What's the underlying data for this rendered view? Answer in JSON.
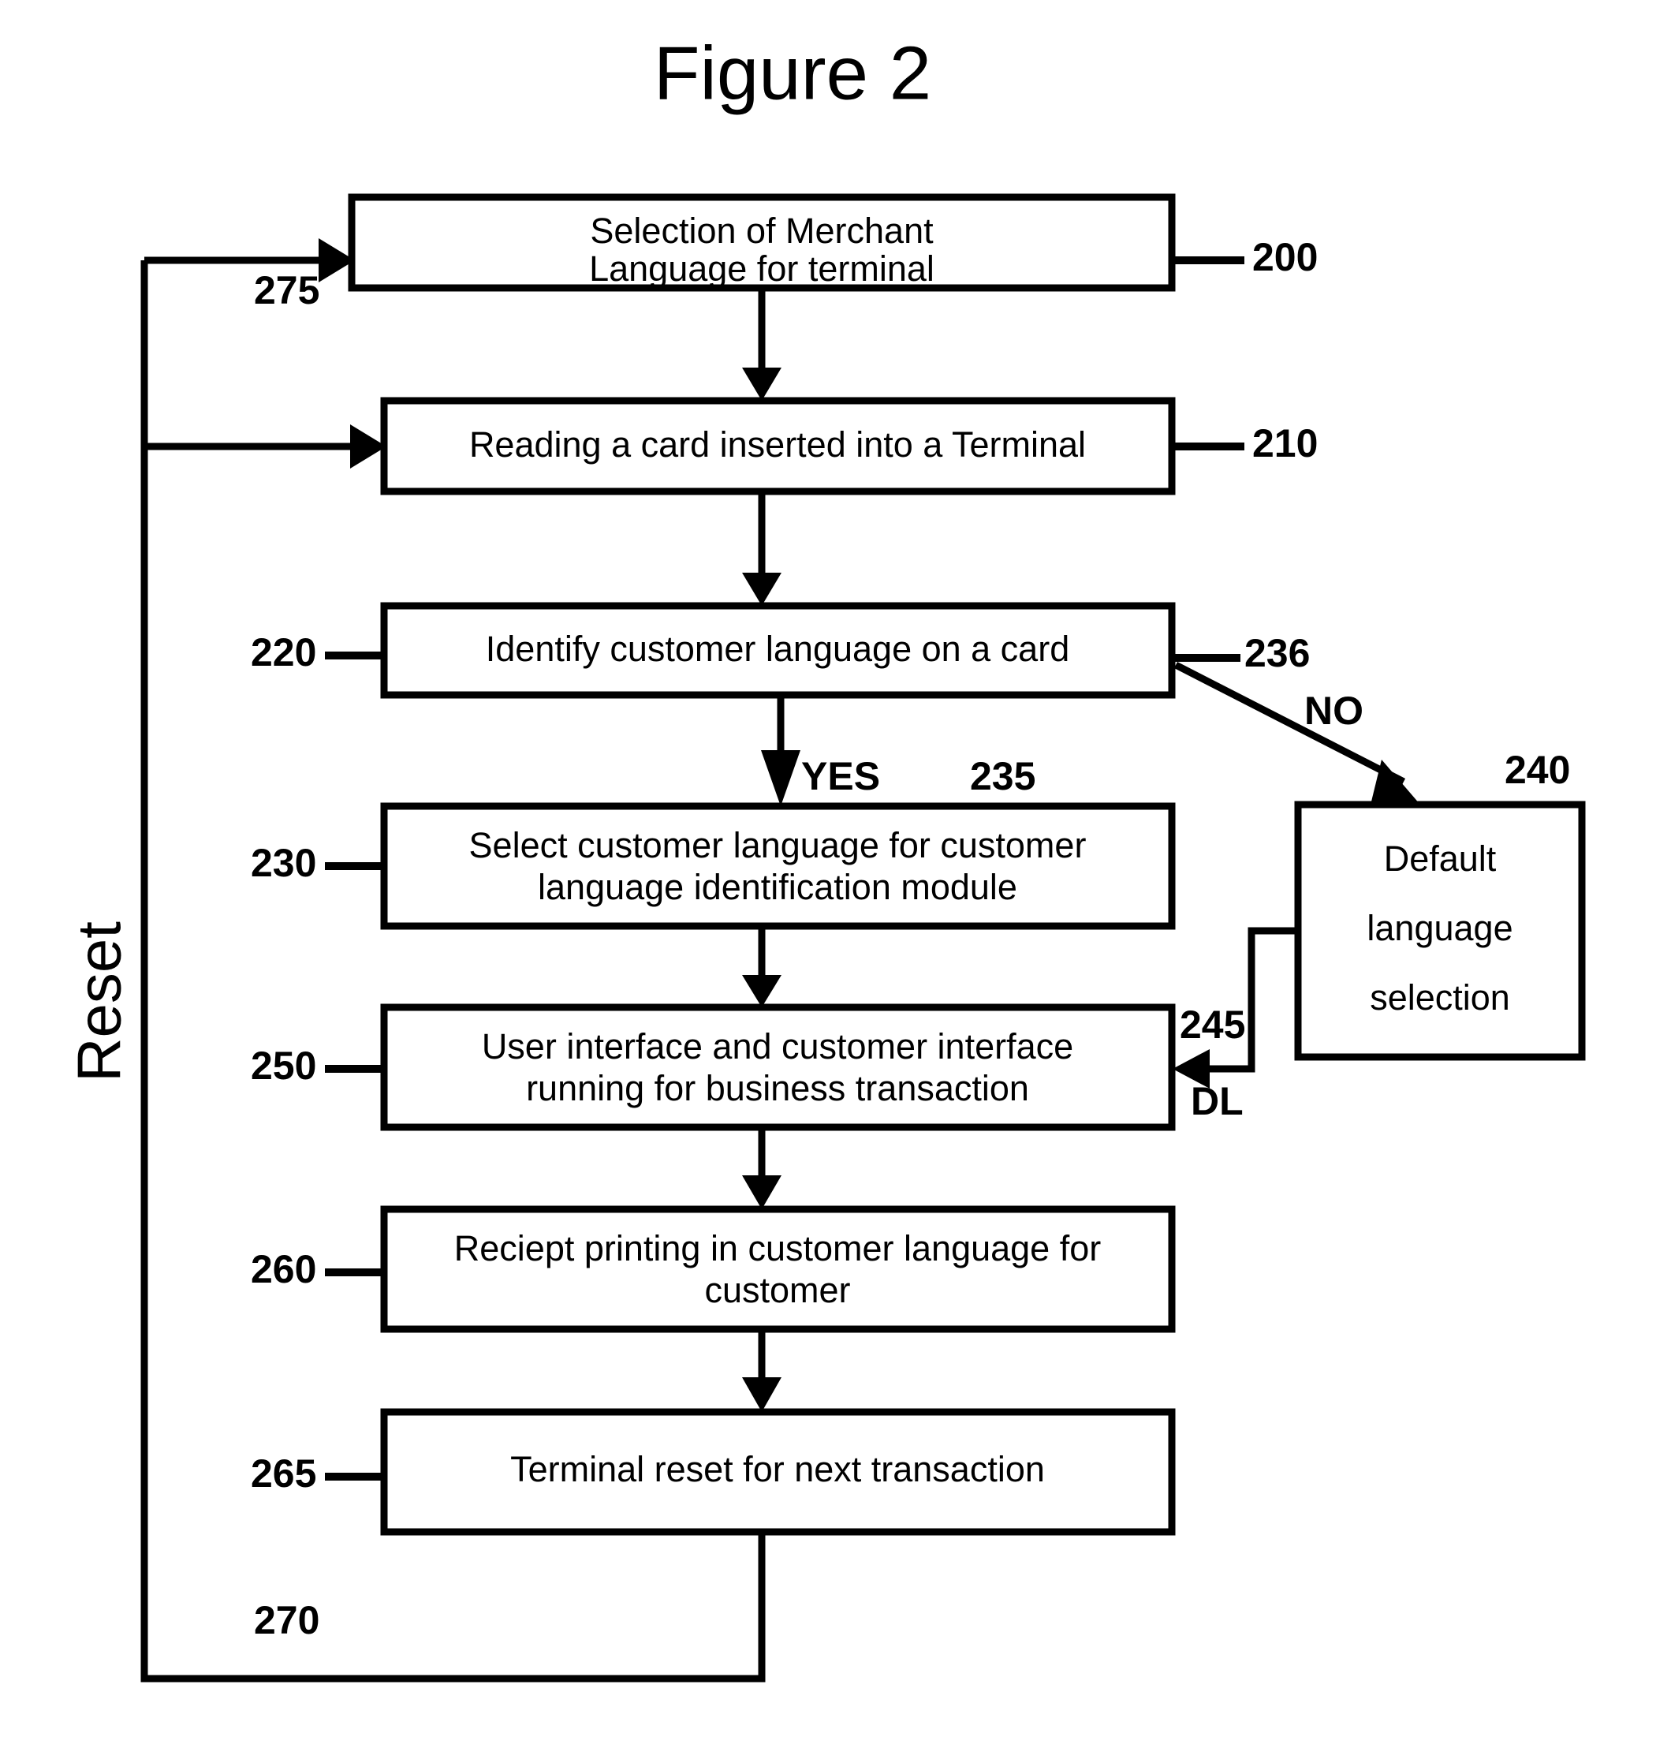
{
  "figure": {
    "title": "Figure 2",
    "type": "patent-flowchart"
  },
  "boxes": [
    {
      "ref": "200",
      "lines": [
        "Selection of Merchant",
        "Language for terminal"
      ]
    },
    {
      "ref": "210",
      "lines": [
        "Reading a card inserted into a Terminal"
      ]
    },
    {
      "ref": "220",
      "lines": [
        "Identify customer language on a card"
      ]
    },
    {
      "ref": "230",
      "lines": [
        "Select customer language for customer",
        "language identification module"
      ]
    },
    {
      "ref": "240",
      "lines": [
        "Default",
        "language",
        "selection"
      ]
    },
    {
      "ref": "250",
      "lines": [
        "User interface and customer interface",
        "running for business transaction"
      ]
    },
    {
      "ref": "260",
      "lines": [
        "Reciept printing in customer language for",
        "customer"
      ]
    },
    {
      "ref": "265",
      "lines": [
        "Terminal reset for next transaction"
      ]
    }
  ],
  "connector_labels": {
    "yes": "YES",
    "no": "NO",
    "dl": "DL",
    "reset": "Reset",
    "ref_235": "235",
    "ref_236": "236",
    "ref_245": "245",
    "ref_270": "270",
    "ref_275": "275"
  }
}
